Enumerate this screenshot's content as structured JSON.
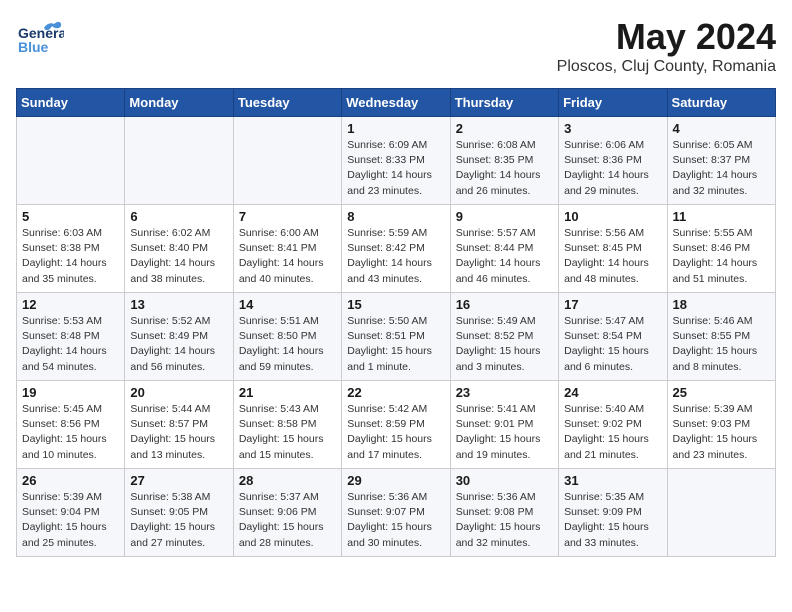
{
  "header": {
    "logo_line1": "General",
    "logo_line2": "Blue",
    "month_year": "May 2024",
    "location": "Ploscos, Cluj County, Romania"
  },
  "weekdays": [
    "Sunday",
    "Monday",
    "Tuesday",
    "Wednesday",
    "Thursday",
    "Friday",
    "Saturday"
  ],
  "weeks": [
    [
      {
        "day": "",
        "info": ""
      },
      {
        "day": "",
        "info": ""
      },
      {
        "day": "",
        "info": ""
      },
      {
        "day": "1",
        "info": "Sunrise: 6:09 AM\nSunset: 8:33 PM\nDaylight: 14 hours\nand 23 minutes."
      },
      {
        "day": "2",
        "info": "Sunrise: 6:08 AM\nSunset: 8:35 PM\nDaylight: 14 hours\nand 26 minutes."
      },
      {
        "day": "3",
        "info": "Sunrise: 6:06 AM\nSunset: 8:36 PM\nDaylight: 14 hours\nand 29 minutes."
      },
      {
        "day": "4",
        "info": "Sunrise: 6:05 AM\nSunset: 8:37 PM\nDaylight: 14 hours\nand 32 minutes."
      }
    ],
    [
      {
        "day": "5",
        "info": "Sunrise: 6:03 AM\nSunset: 8:38 PM\nDaylight: 14 hours\nand 35 minutes."
      },
      {
        "day": "6",
        "info": "Sunrise: 6:02 AM\nSunset: 8:40 PM\nDaylight: 14 hours\nand 38 minutes."
      },
      {
        "day": "7",
        "info": "Sunrise: 6:00 AM\nSunset: 8:41 PM\nDaylight: 14 hours\nand 40 minutes."
      },
      {
        "day": "8",
        "info": "Sunrise: 5:59 AM\nSunset: 8:42 PM\nDaylight: 14 hours\nand 43 minutes."
      },
      {
        "day": "9",
        "info": "Sunrise: 5:57 AM\nSunset: 8:44 PM\nDaylight: 14 hours\nand 46 minutes."
      },
      {
        "day": "10",
        "info": "Sunrise: 5:56 AM\nSunset: 8:45 PM\nDaylight: 14 hours\nand 48 minutes."
      },
      {
        "day": "11",
        "info": "Sunrise: 5:55 AM\nSunset: 8:46 PM\nDaylight: 14 hours\nand 51 minutes."
      }
    ],
    [
      {
        "day": "12",
        "info": "Sunrise: 5:53 AM\nSunset: 8:48 PM\nDaylight: 14 hours\nand 54 minutes."
      },
      {
        "day": "13",
        "info": "Sunrise: 5:52 AM\nSunset: 8:49 PM\nDaylight: 14 hours\nand 56 minutes."
      },
      {
        "day": "14",
        "info": "Sunrise: 5:51 AM\nSunset: 8:50 PM\nDaylight: 14 hours\nand 59 minutes."
      },
      {
        "day": "15",
        "info": "Sunrise: 5:50 AM\nSunset: 8:51 PM\nDaylight: 15 hours\nand 1 minute."
      },
      {
        "day": "16",
        "info": "Sunrise: 5:49 AM\nSunset: 8:52 PM\nDaylight: 15 hours\nand 3 minutes."
      },
      {
        "day": "17",
        "info": "Sunrise: 5:47 AM\nSunset: 8:54 PM\nDaylight: 15 hours\nand 6 minutes."
      },
      {
        "day": "18",
        "info": "Sunrise: 5:46 AM\nSunset: 8:55 PM\nDaylight: 15 hours\nand 8 minutes."
      }
    ],
    [
      {
        "day": "19",
        "info": "Sunrise: 5:45 AM\nSunset: 8:56 PM\nDaylight: 15 hours\nand 10 minutes."
      },
      {
        "day": "20",
        "info": "Sunrise: 5:44 AM\nSunset: 8:57 PM\nDaylight: 15 hours\nand 13 minutes."
      },
      {
        "day": "21",
        "info": "Sunrise: 5:43 AM\nSunset: 8:58 PM\nDaylight: 15 hours\nand 15 minutes."
      },
      {
        "day": "22",
        "info": "Sunrise: 5:42 AM\nSunset: 8:59 PM\nDaylight: 15 hours\nand 17 minutes."
      },
      {
        "day": "23",
        "info": "Sunrise: 5:41 AM\nSunset: 9:01 PM\nDaylight: 15 hours\nand 19 minutes."
      },
      {
        "day": "24",
        "info": "Sunrise: 5:40 AM\nSunset: 9:02 PM\nDaylight: 15 hours\nand 21 minutes."
      },
      {
        "day": "25",
        "info": "Sunrise: 5:39 AM\nSunset: 9:03 PM\nDaylight: 15 hours\nand 23 minutes."
      }
    ],
    [
      {
        "day": "26",
        "info": "Sunrise: 5:39 AM\nSunset: 9:04 PM\nDaylight: 15 hours\nand 25 minutes."
      },
      {
        "day": "27",
        "info": "Sunrise: 5:38 AM\nSunset: 9:05 PM\nDaylight: 15 hours\nand 27 minutes."
      },
      {
        "day": "28",
        "info": "Sunrise: 5:37 AM\nSunset: 9:06 PM\nDaylight: 15 hours\nand 28 minutes."
      },
      {
        "day": "29",
        "info": "Sunrise: 5:36 AM\nSunset: 9:07 PM\nDaylight: 15 hours\nand 30 minutes."
      },
      {
        "day": "30",
        "info": "Sunrise: 5:36 AM\nSunset: 9:08 PM\nDaylight: 15 hours\nand 32 minutes."
      },
      {
        "day": "31",
        "info": "Sunrise: 5:35 AM\nSunset: 9:09 PM\nDaylight: 15 hours\nand 33 minutes."
      },
      {
        "day": "",
        "info": ""
      }
    ]
  ]
}
